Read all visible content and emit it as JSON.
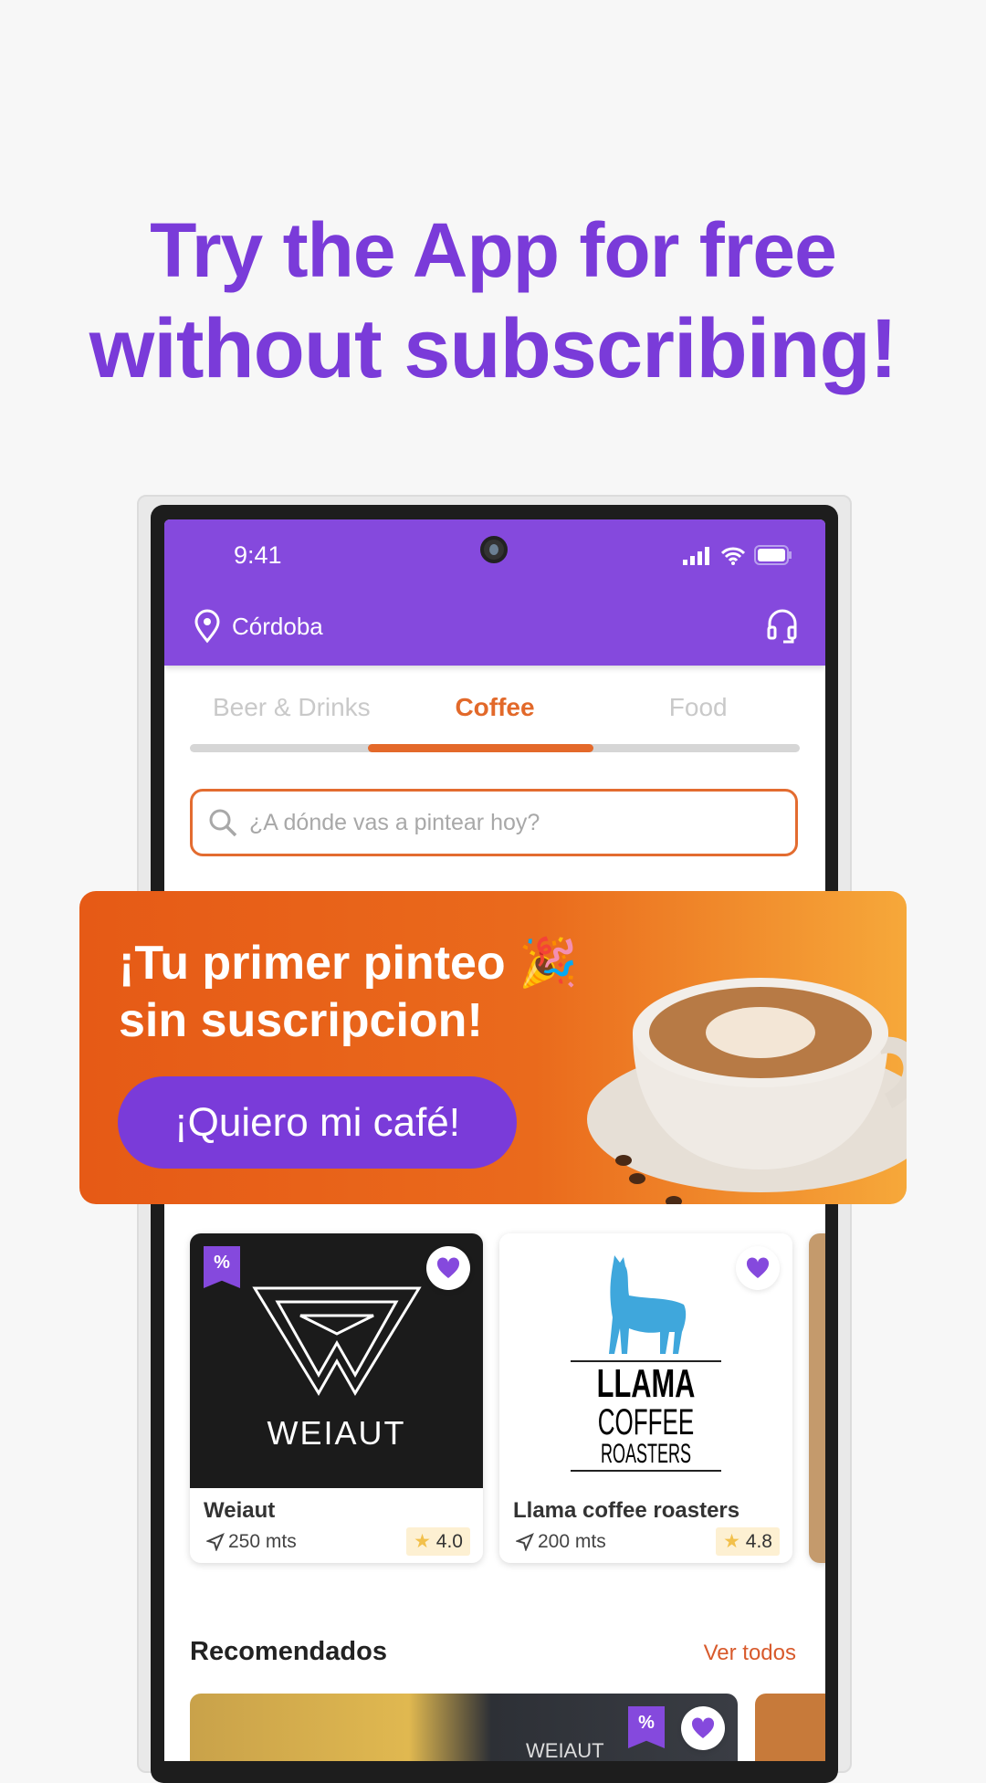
{
  "headline": {
    "line1": "Try the App for free",
    "line2": "without subscribing!"
  },
  "status": {
    "time": "9:41"
  },
  "header": {
    "location": "Córdoba"
  },
  "tabs": [
    {
      "label": "Beer & Drinks"
    },
    {
      "label": "Coffee",
      "active": true
    },
    {
      "label": "Food"
    }
  ],
  "search": {
    "placeholder": "¿A dónde vas a pintear hoy?"
  },
  "promo": {
    "line1": "¡Tu primer pinteo 🎉",
    "line2": "sin suscripcion!",
    "button": "¡Quiero mi café!"
  },
  "places": [
    {
      "name": "Weiaut",
      "logo": "WEIAUT",
      "distance": "250 mts",
      "rating": "4.0",
      "discount": "%"
    },
    {
      "name": "Llama coffee roasters",
      "logo": [
        "LLAMA",
        "COFFEE",
        "ROASTERS"
      ],
      "distance": "200 mts",
      "rating": "4.8"
    }
  ],
  "recommended": {
    "title": "Recomendados",
    "see_all": "Ver todos",
    "card_logo": "WEIAUT",
    "discount": "%"
  },
  "colors": {
    "brand_purple": "#8549dd",
    "accent_orange": "#e4692a"
  }
}
